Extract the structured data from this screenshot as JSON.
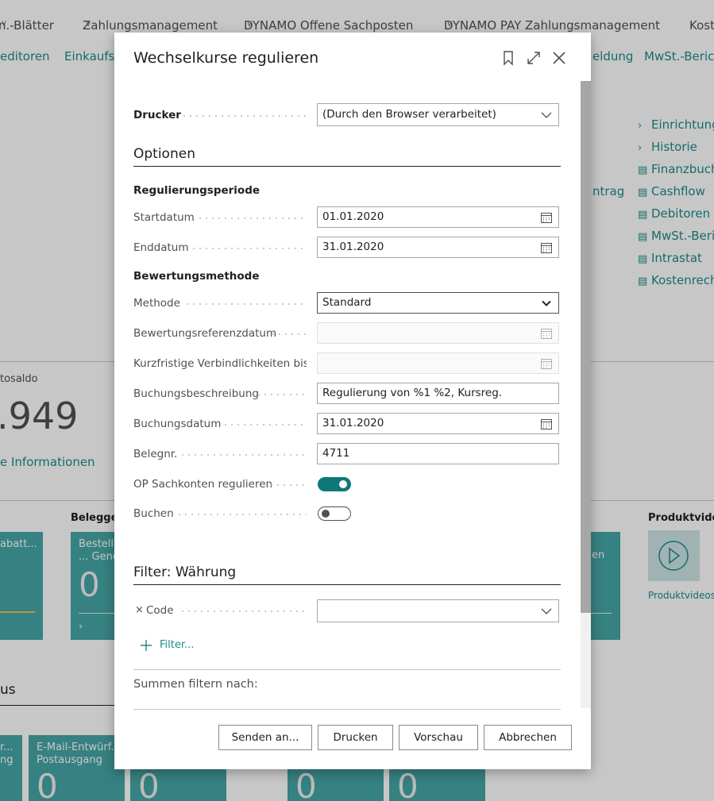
{
  "background": {
    "nav_top": [
      {
        "label": "n.-Blätter"
      },
      {
        "label": "Zahlungsmanagement"
      },
      {
        "label": "DYNAMO Offene Sachposten"
      },
      {
        "label": "DYNAMO PAY Zahlungsmanagement"
      },
      {
        "label": "Kost"
      }
    ],
    "nav_second": [
      "editoren",
      "Einkaufsb",
      "eldung",
      "MwSt.-Berich"
    ],
    "right_links": [
      {
        "label": "Einrichtung",
        "icon": "chevron-right-icon"
      },
      {
        "label": "Historie",
        "icon": "chevron-right-icon"
      },
      {
        "label": "Finanzbuch",
        "icon": "report-icon"
      },
      {
        "label": "Cashflow",
        "icon": "report-icon"
      },
      {
        "label": "Debitoren u",
        "icon": "report-icon"
      },
      {
        "label": "MwSt.-Beric",
        "icon": "report-icon"
      },
      {
        "label": "Intrastat",
        "icon": "report-icon"
      },
      {
        "label": "Kostenrech",
        "icon": "report-icon"
      }
    ],
    "trag_text": "ntrag",
    "kpi_label": "tosaldo",
    "kpi_value": ".949",
    "info_link": "e Informationen",
    "beleg_label": "Beleggen",
    "produkt_label": "Produktvideo",
    "produkt_link": "Produktvideos",
    "tile_rabatt": "abatt...",
    "tile_bestell": "Bestellu\n... Gene",
    "tile_bestell_value": "0",
    "tile_en": "en",
    "status_label": "us",
    "bottom_tiles": [
      {
        "title": "r...\nng",
        "value": ""
      },
      {
        "title": "E-Mail-Entwürf...\nPostausgang",
        "value": "0"
      },
      {
        "title": "",
        "value": "0"
      },
      {
        "title": "",
        "value": "0"
      },
      {
        "title": "",
        "value": "0"
      }
    ]
  },
  "dialog": {
    "title": "Wechselkurse regulieren",
    "printer": {
      "label": "Drucker",
      "value": "(Durch den Browser verarbeitet)"
    },
    "options_title": "Optionen",
    "period_title": "Regulierungsperiode",
    "start": {
      "label": "Startdatum",
      "value": "01.01.2020"
    },
    "end": {
      "label": "Enddatum",
      "value": "31.01.2020"
    },
    "valuation_title": "Bewertungsmethode",
    "method": {
      "label": "Methode",
      "value": "Standard"
    },
    "ref_date": {
      "label": "Bewertungsreferenzdatum",
      "value": ""
    },
    "short_liab": {
      "label": "Kurzfristige Verbindlichkeiten bis",
      "value": ""
    },
    "posting_desc": {
      "label": "Buchungsbeschreibung",
      "value": "Regulierung von %1 %2, Kursreg."
    },
    "posting_date": {
      "label": "Buchungsdatum",
      "value": "31.01.2020"
    },
    "doc_no": {
      "label": "Belegnr.",
      "value": "4711"
    },
    "adjust_gl": {
      "label": "OP Sachkonten regulieren",
      "on": true
    },
    "post": {
      "label": "Buchen",
      "on": false
    },
    "filter_title": "Filter: Währung",
    "code": {
      "label": "Code",
      "value": ""
    },
    "add_filter": "Filter...",
    "totals_title": "Summen filtern nach:",
    "buttons": {
      "send": "Senden an...",
      "print": "Drucken",
      "preview": "Vorschau",
      "cancel": "Abbrechen"
    }
  }
}
